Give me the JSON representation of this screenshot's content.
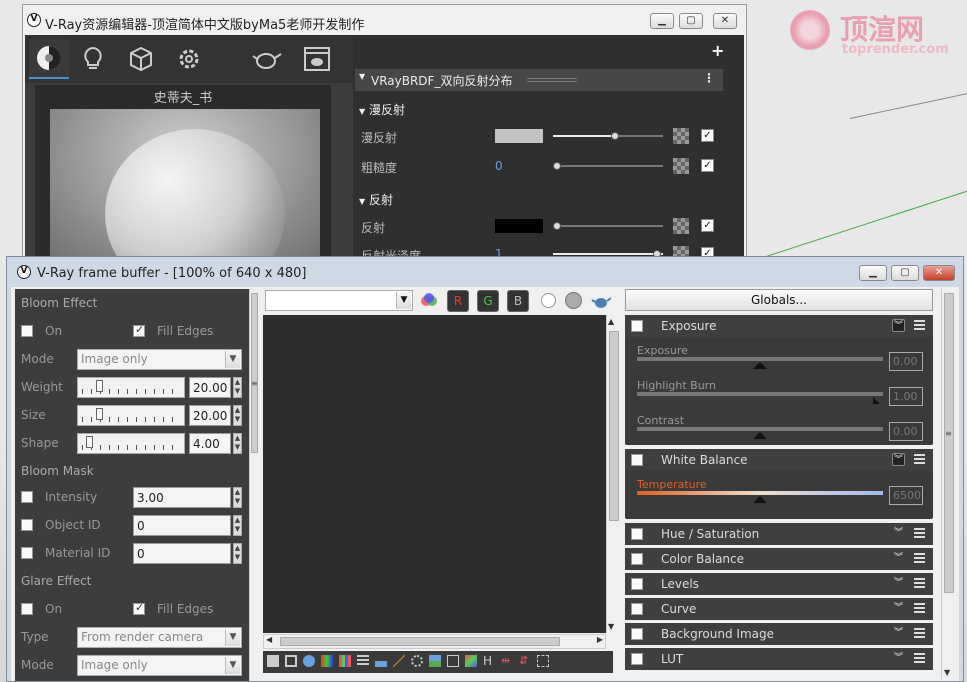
{
  "watermark": {
    "title": "顶渲网",
    "url": "toprender.com"
  },
  "asset_editor": {
    "title": "V-Ray资源编辑器-顶渲简体中文版byMa5老师开发制作",
    "tabs": [
      "material-icon",
      "light-icon",
      "geometry-icon",
      "settings-icon",
      "teapot-icon",
      "render-output-icon"
    ],
    "preview_name": "史蒂夫_书",
    "section_title": "VRayBRDF_双向反射分布",
    "diffuse_group": "漫反射",
    "diffuse_label": "漫反射",
    "diffuse_color": "#c3c3c3",
    "roughness_label": "粗糙度",
    "roughness_value": "0",
    "reflection_group": "反射",
    "reflection_label": "反射",
    "reflection_color": "#000000",
    "refl_gloss_label": "反射光泽度",
    "refl_gloss_value": "1",
    "add_label": "+"
  },
  "frame_buffer": {
    "title": "V-Ray frame buffer - [100% of 640 x 480]",
    "bloom": {
      "header": "Bloom Effect",
      "on": "On",
      "fill_edges": "Fill Edges",
      "mode_label": "Mode",
      "mode_value": "Image only",
      "weight_label": "Weight",
      "weight_value": "20.00",
      "size_label": "Size",
      "size_value": "20.00",
      "shape_label": "Shape",
      "shape_value": "4.00"
    },
    "bloom_mask": {
      "header": "Bloom Mask",
      "intensity_label": "Intensity",
      "intensity_value": "3.00",
      "object_id_label": "Object ID",
      "object_id_value": "0",
      "material_id_label": "Material ID",
      "material_id_value": "0"
    },
    "glare": {
      "header": "Glare Effect",
      "on": "On",
      "fill_edges": "Fill Edges",
      "type_label": "Type",
      "type_value": "From render camera",
      "mode_label": "Mode",
      "mode_value": "Image only"
    },
    "toolbar": {
      "channel_value": "",
      "r": "R",
      "g": "G",
      "b": "B"
    },
    "globals": "Globals...",
    "exposure": {
      "title": "Exposure",
      "exposure_label": "Exposure",
      "exposure_value": "0.00",
      "highlight_label": "Highlight Burn",
      "highlight_value": "1.00",
      "contrast_label": "Contrast",
      "contrast_value": "0.00"
    },
    "white_balance": {
      "title": "White Balance",
      "temperature_label": "Temperature",
      "temperature_value": "6500"
    },
    "collapsed": [
      "Hue / Saturation",
      "Color Balance",
      "Levels",
      "Curve",
      "Background Image",
      "LUT"
    ]
  },
  "colors": {
    "dark_bg": "#3d3d3d",
    "accent_orange": "#e06020"
  }
}
